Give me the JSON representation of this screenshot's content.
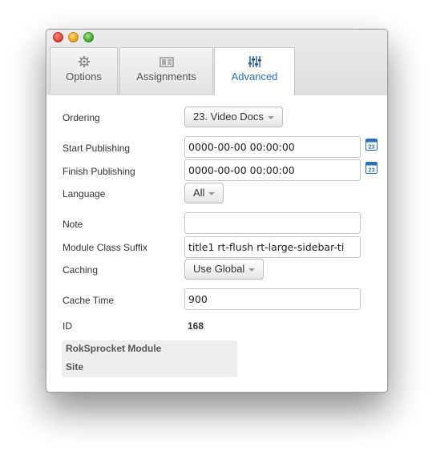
{
  "window": {
    "traffic_lights": [
      "close",
      "minimize",
      "zoom"
    ]
  },
  "tabs": [
    {
      "label": "Options",
      "icon": "gear-icon"
    },
    {
      "label": "Assignments",
      "icon": "assignments-icon"
    },
    {
      "label": "Advanced",
      "icon": "sliders-icon",
      "active": true
    }
  ],
  "fields": {
    "ordering_label": "Ordering",
    "ordering_value": "23. Video Docs",
    "start_label": "Start Publishing",
    "start_value": "0000-00-00 00:00:00",
    "finish_label": "Finish Publishing",
    "finish_value": "0000-00-00 00:00:00",
    "calendar_icon_text": "23",
    "language_label": "Language",
    "language_value": "All",
    "note_label": "Note",
    "note_value": "",
    "suffix_label": "Module Class Suffix",
    "suffix_value": "title1 rt-flush rt-large-sidebar-ti",
    "caching_label": "Caching",
    "caching_value": "Use Global",
    "cachetime_label": "Cache Time",
    "cachetime_value": "900",
    "id_label": "ID",
    "id_value": "168"
  },
  "info": {
    "line1": "RokSprocket Module",
    "line2": "Site"
  },
  "colors": {
    "active_tab_text": "#2a6cc4",
    "calendar_blue": "#2f6fb5"
  }
}
